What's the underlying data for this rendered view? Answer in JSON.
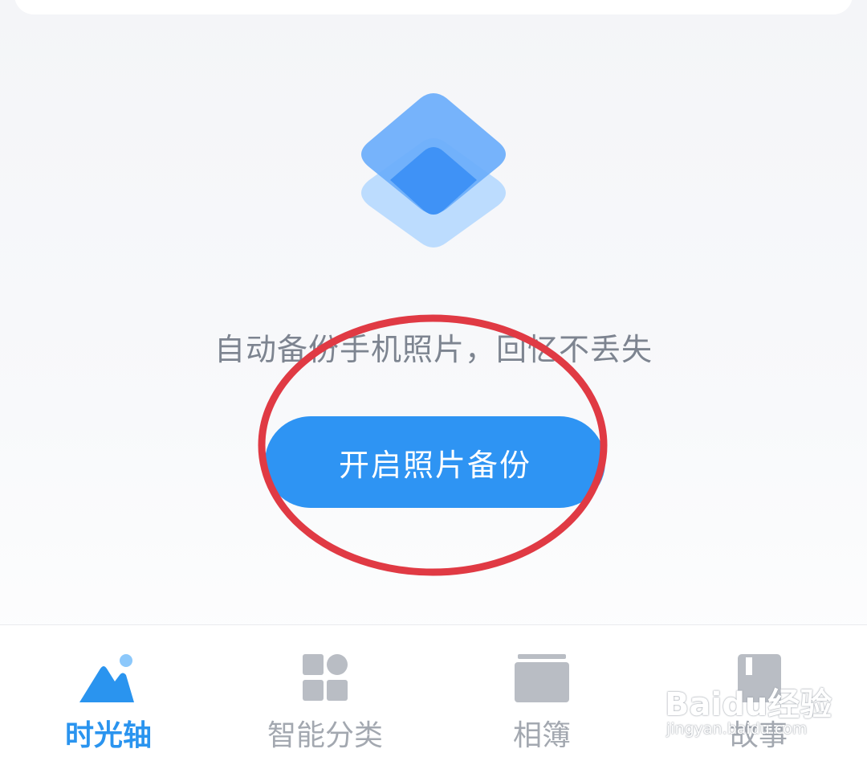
{
  "colors": {
    "accent": "#2e94f3",
    "active_tab": "#2a94ef",
    "inactive_tab": "#a3a8b0",
    "message_text": "#7d8490",
    "annotation": "#e03a44"
  },
  "empty_state": {
    "icon": "layers-icon",
    "message": "自动备份手机照片，回忆不丢失",
    "button_label": "开启照片备份"
  },
  "tabbar": {
    "tabs": [
      {
        "label": "时光轴",
        "icon": "mountain-sun-icon",
        "active": true
      },
      {
        "label": "智能分类",
        "icon": "grid-category-icon",
        "active": false
      },
      {
        "label": "相簿",
        "icon": "album-icon",
        "active": false
      },
      {
        "label": "故事",
        "icon": "story-icon",
        "active": false
      }
    ]
  },
  "watermark": {
    "brand": "Baidu经验",
    "site": "jingyan.baidu.com"
  }
}
